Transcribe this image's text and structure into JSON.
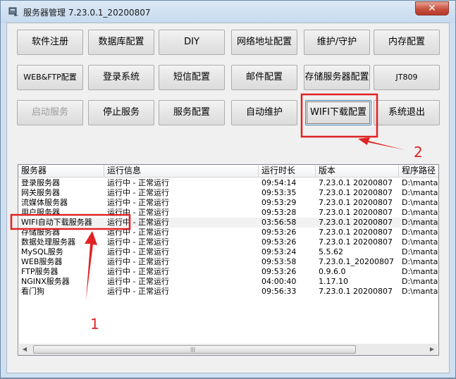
{
  "window": {
    "title": "服务器管理 7.23.0.1_20200807",
    "close_icon": "close-icon",
    "close_label": "✕"
  },
  "buttons": {
    "row1": [
      "软件注册",
      "数据库配置",
      "DIY",
      "网络地址配置",
      "维护/守护",
      "内存配置"
    ],
    "row2": [
      "WEB&FTP配置",
      "登录系统",
      "短信配置",
      "邮件配置",
      "存储服务器配置",
      "JT809"
    ],
    "row3": [
      "启动服务",
      "停止服务",
      "服务配置",
      "自动维护",
      "WIFI下载配置",
      "系统退出"
    ]
  },
  "list": {
    "columns": [
      "服务器",
      "运行信息",
      "运行时长",
      "版本",
      "程序路径"
    ],
    "rows": [
      [
        "登录服务器",
        "运行中 - 正常运行",
        "09:54:14",
        "7.23.0.1 20200807",
        "D:\\mantain"
      ],
      [
        "网关服务器",
        "运行中 - 正常运行",
        "09:53:35",
        "7.23.0.1 20200807",
        "D:\\mantain"
      ],
      [
        "流媒体服务器",
        "运行中 - 正常运行",
        "09:53:29",
        "7.23.0.1 20200807",
        "D:\\mantain"
      ],
      [
        "用户服务器",
        "运行中 - 正常运行",
        "09:53:28",
        "7.23.0.1 20200807",
        "D:\\mantain"
      ],
      [
        "WIFI自动下载服务器",
        "运行中 - 正常运行",
        "03:56:58",
        "7.23.0.1 20200807",
        "D:\\mantain"
      ],
      [
        "存储服务器",
        "运行中 - 正常运行",
        "09:53:26",
        "7.23.0.1 20200807",
        "D:\\mantain"
      ],
      [
        "数据处理服务器",
        "运行中 - 正常运行",
        "09:53:26",
        "7.23.0.1 20200807",
        "D:\\mantain"
      ],
      [
        "MySQL服务",
        "运行中 - 正常运行",
        "09:53:24",
        "5.5.62",
        "D:\\mantain"
      ],
      [
        "WEB服务器",
        "运行中 - 正常运行",
        "09:53:58",
        "7.23.0.1_20200807",
        "D:\\mantain"
      ],
      [
        "FTP服务器",
        "运行中 - 正常运行",
        "09:53:26",
        "0.9.6.0",
        "D:\\mantain"
      ],
      [
        "NGINX服务器",
        "运行中 - 正常运行",
        "04:00:40",
        "1.17.10",
        "D:\\mantain"
      ],
      [
        "看门狗",
        "运行中 - 正常运行",
        "09:56:33",
        "7.23.0.1 20200807",
        "D:\\mantain"
      ]
    ]
  },
  "annotations": {
    "label1": "1",
    "label2": "2",
    "color": "#e02323"
  }
}
